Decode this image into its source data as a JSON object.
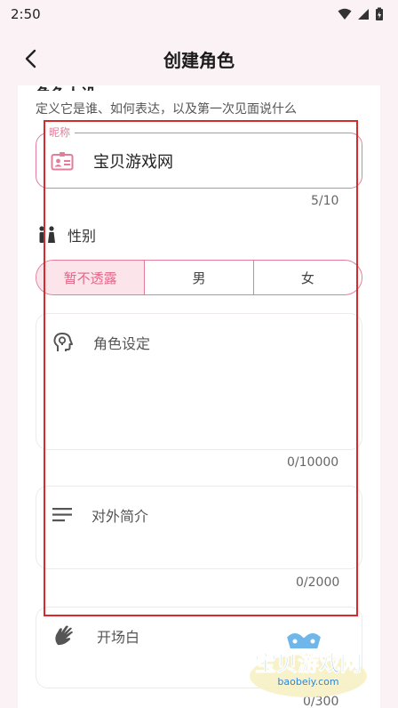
{
  "status_bar": {
    "time": "2:50",
    "icons": [
      "wifi-icon",
      "signal-icon",
      "battery-charging-icon"
    ]
  },
  "app_bar": {
    "title": "创建角色",
    "back_icon": "chevron-left-icon"
  },
  "section": {
    "heading_partial": "角色人设",
    "description": "定义它是谁、如何表达，以及第一次见面说什么"
  },
  "nickname": {
    "legend": "昵称",
    "value": "宝贝游戏网",
    "counter": "5/10",
    "icon": "id-card-icon"
  },
  "gender": {
    "label": "性别",
    "icon": "people-icon",
    "options": [
      "暂不透露",
      "男",
      "女"
    ],
    "selected_index": 0
  },
  "role_setting": {
    "label": "角色设定",
    "counter": "0/10000",
    "icon": "head-bulb-icon"
  },
  "intro": {
    "label": "对外简介",
    "counter": "0/2000",
    "icon": "lines-icon"
  },
  "opening": {
    "label": "开场白",
    "counter": "0/300",
    "icon": "waving-hand-icon"
  },
  "watermark": {
    "text": "宝贝游戏网",
    "url": "baobeiy.com"
  },
  "colors": {
    "accent": "#e27e9b",
    "selected_bg": "#fbe4ea",
    "highlight_box": "#d82a2a",
    "page_bg": "#faf2f5"
  }
}
